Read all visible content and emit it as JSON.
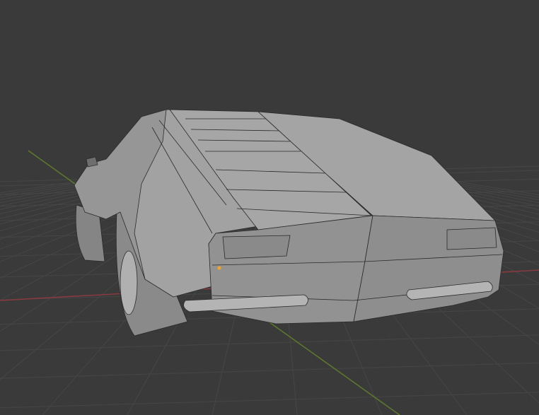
{
  "viewport": {
    "background_color": "#3a3a3a",
    "grid_color": "#464646",
    "x_axis_color": "#8a3a3f",
    "y_axis_color": "#5d7a2c",
    "origin_marker_color": "#f5a623"
  },
  "model": {
    "icon": "car-mesh-icon",
    "body_color": "#9c9c9c",
    "body_dark_color": "#858585",
    "body_light_color": "#a8a8a8",
    "edge_color": "#2a2a2a",
    "tire_color": "#7e7e7e",
    "light_color": "#8f8f8f"
  }
}
